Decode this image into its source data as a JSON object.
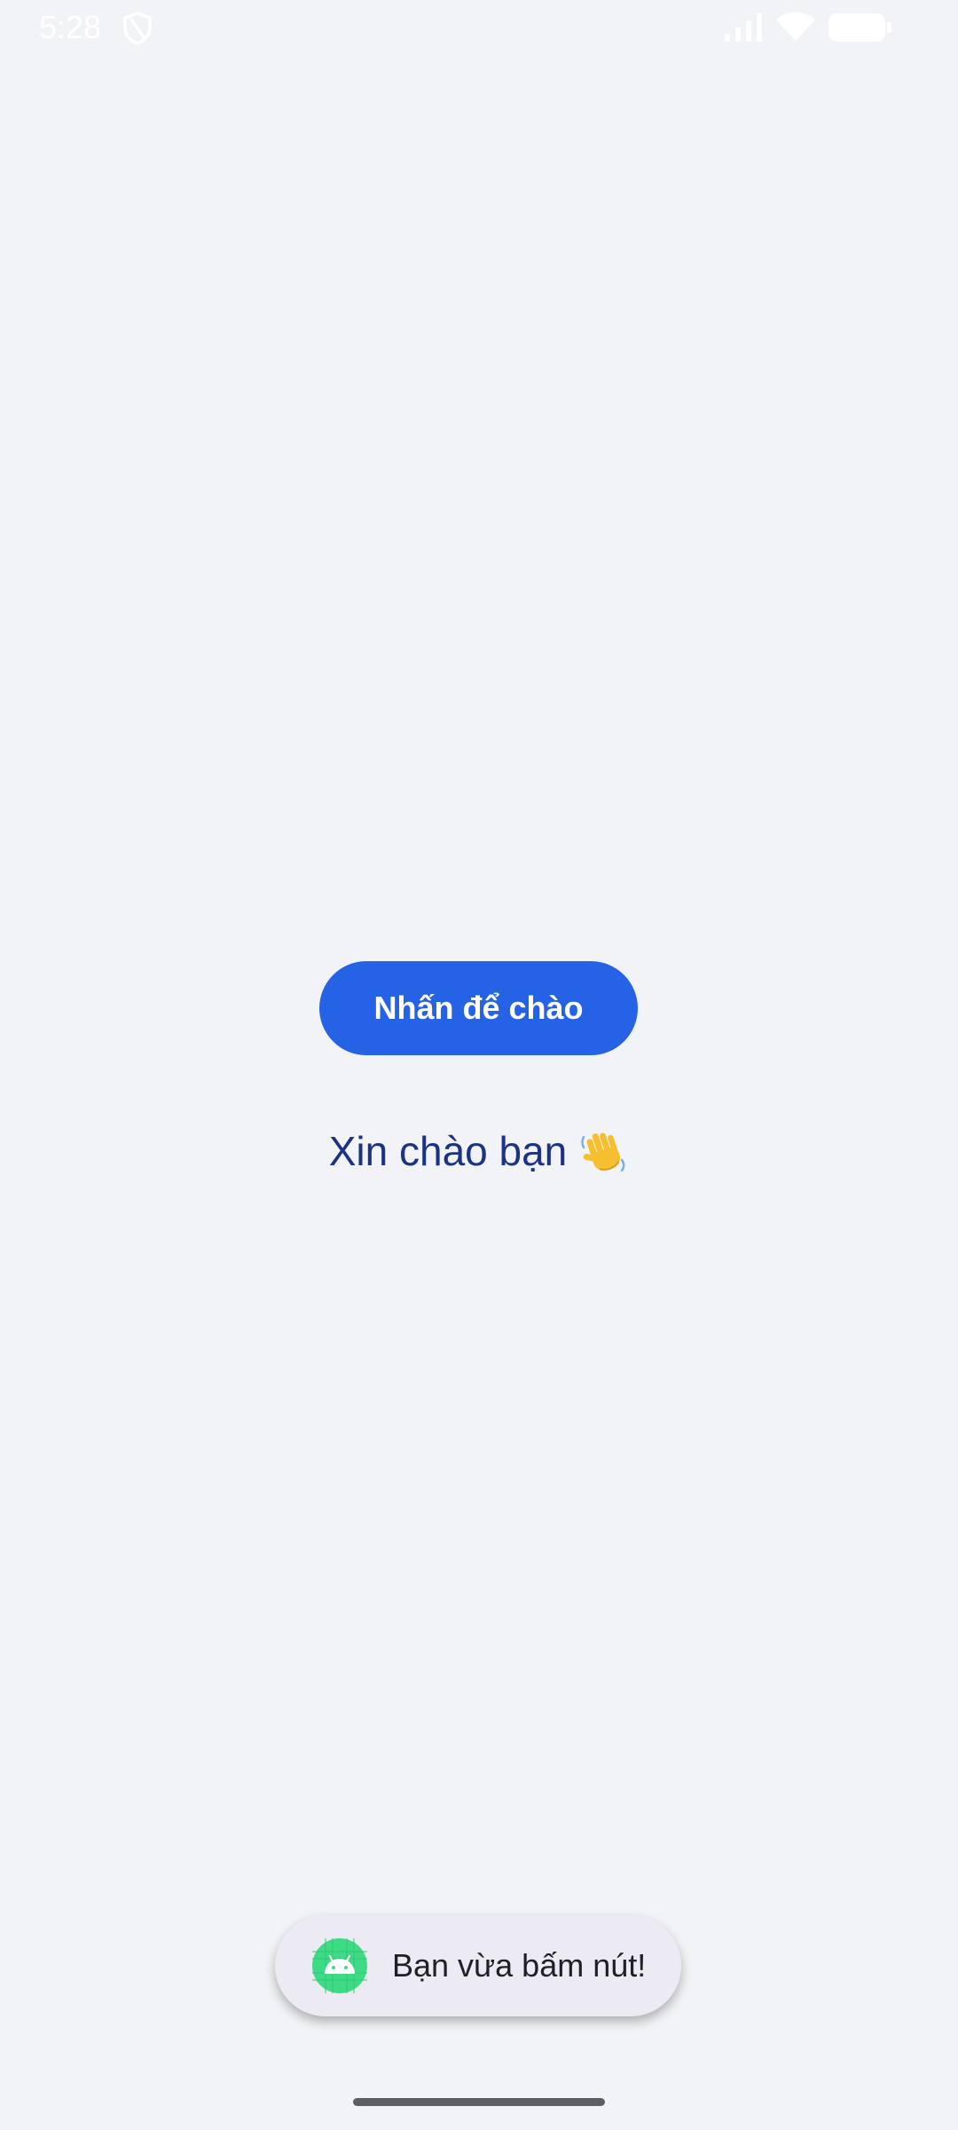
{
  "status_bar": {
    "time": "5:28",
    "icons": [
      "shield-icon",
      "signal-icon",
      "wifi-icon",
      "battery-icon"
    ]
  },
  "main": {
    "button_label": "Nhấn để chào",
    "greeting": "Xin chào bạn",
    "greeting_emoji": "waving-hand-icon"
  },
  "toast": {
    "message": "Bạn vừa bấm nút!",
    "icon": "android-app-icon"
  },
  "colors": {
    "background": "#f2f3f6",
    "button": "#2562e6",
    "greeting_text": "#1c3384",
    "toast_background": "#ecebf4"
  }
}
